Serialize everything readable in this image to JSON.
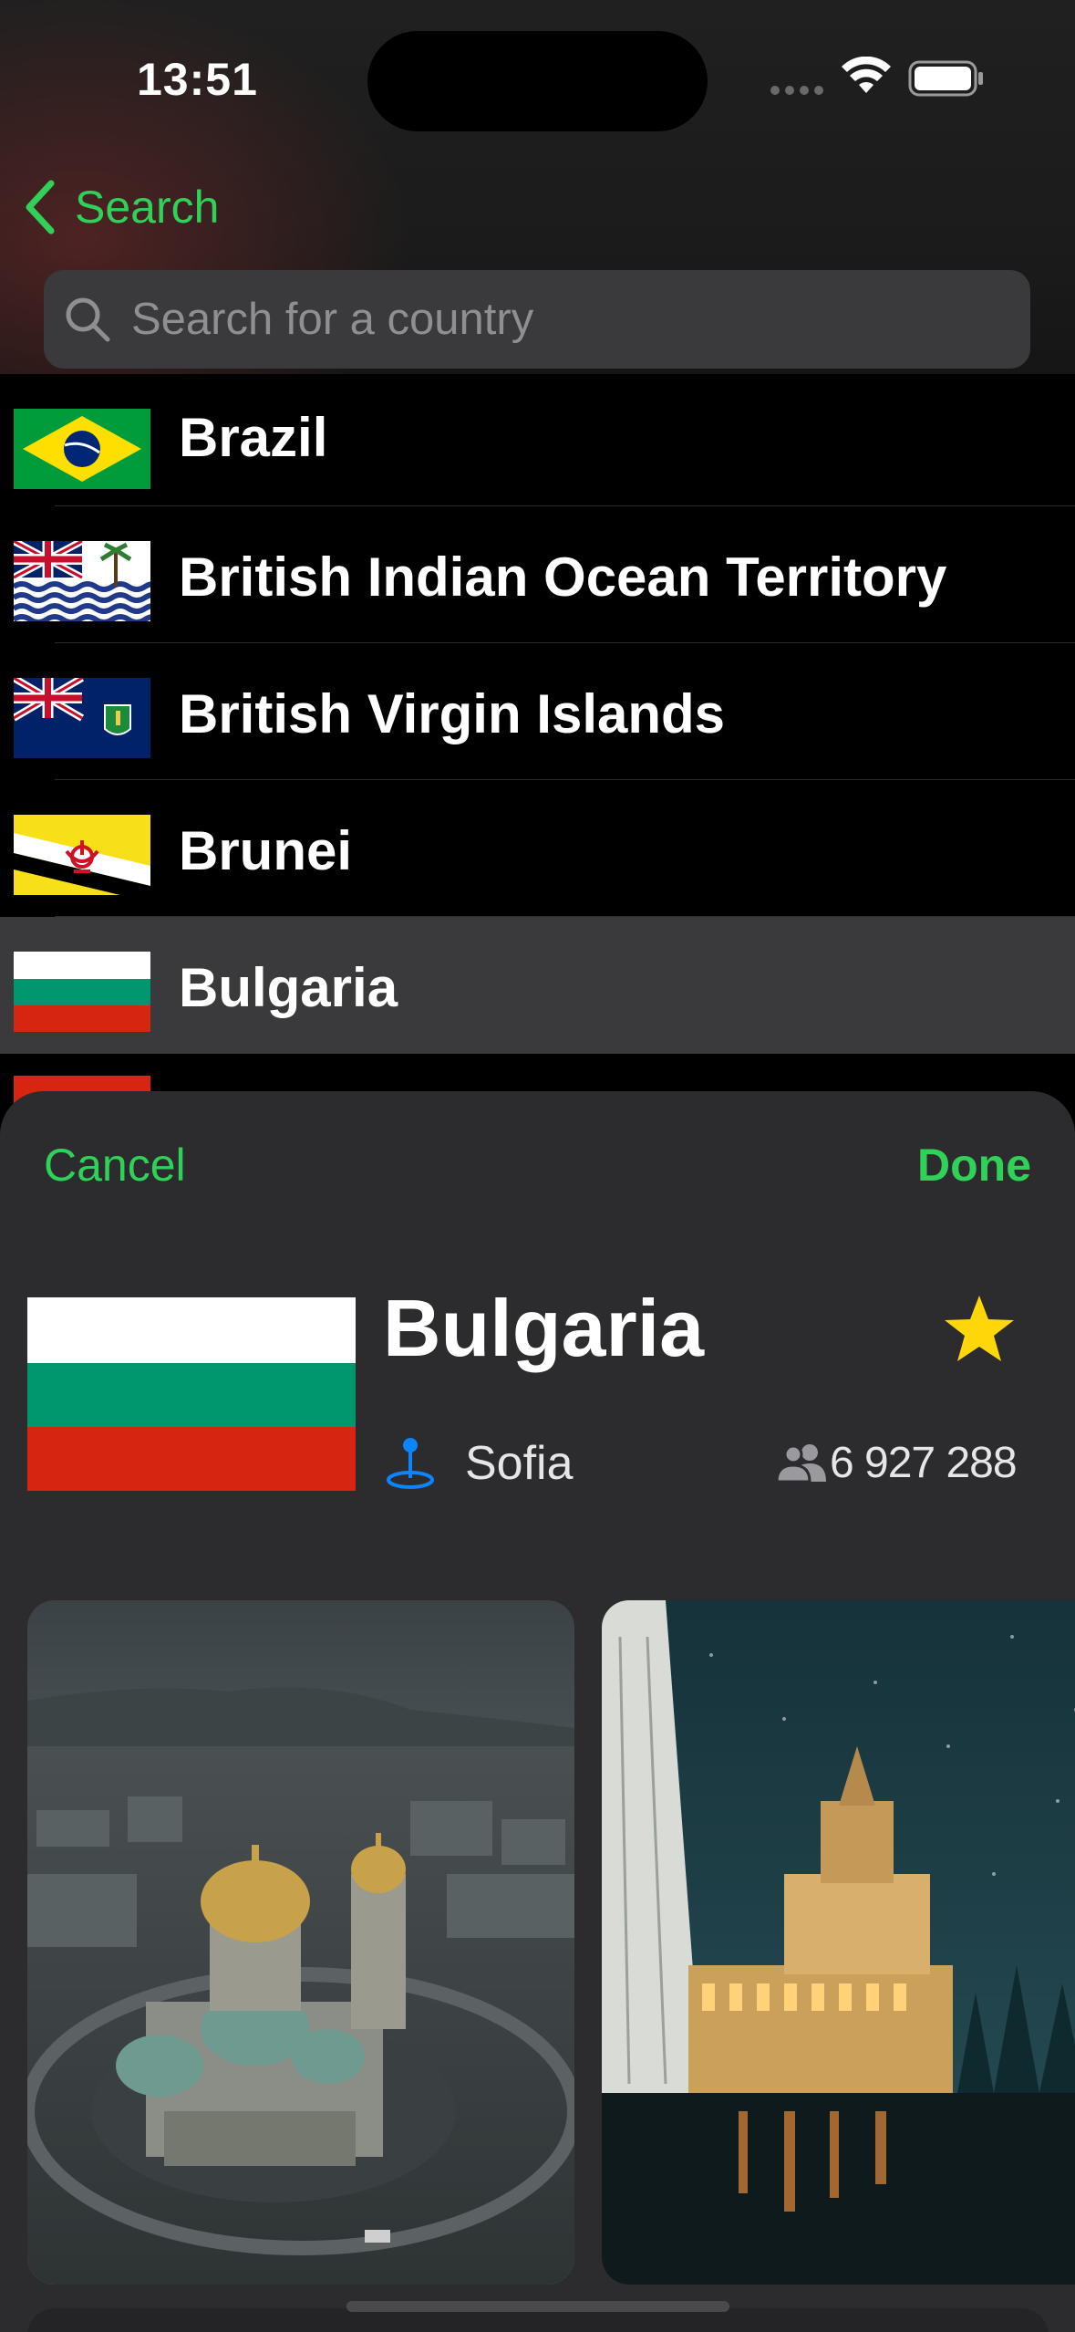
{
  "status_bar": {
    "time": "13:51"
  },
  "nav": {
    "back_label": "Search"
  },
  "search": {
    "placeholder": "Search for a country"
  },
  "countries": [
    {
      "name": "Brazil",
      "flag": "brazil-flag"
    },
    {
      "name": "British Indian Ocean Territory",
      "flag": "british-indian-ocean-territory-flag"
    },
    {
      "name": "British Virgin Islands",
      "flag": "british-virgin-islands-flag"
    },
    {
      "name": "Brunei",
      "flag": "brunei-flag"
    },
    {
      "name": "Bulgaria",
      "flag": "bulgaria-flag",
      "selected": true
    }
  ],
  "detail": {
    "cancel_label": "Cancel",
    "done_label": "Done",
    "name": "Bulgaria",
    "capital": "Sofia",
    "population": "6 927 288",
    "favorite": true,
    "photos": [
      "alexander-nevsky-cathedral-photo",
      "largo-building-night-photo"
    ]
  },
  "colors": {
    "accent": "#30d158",
    "star": "#ffd60a",
    "capital_icon": "#0a84ff",
    "selected_row": "#3a3a3c",
    "sheet": "#2c2c2e"
  }
}
